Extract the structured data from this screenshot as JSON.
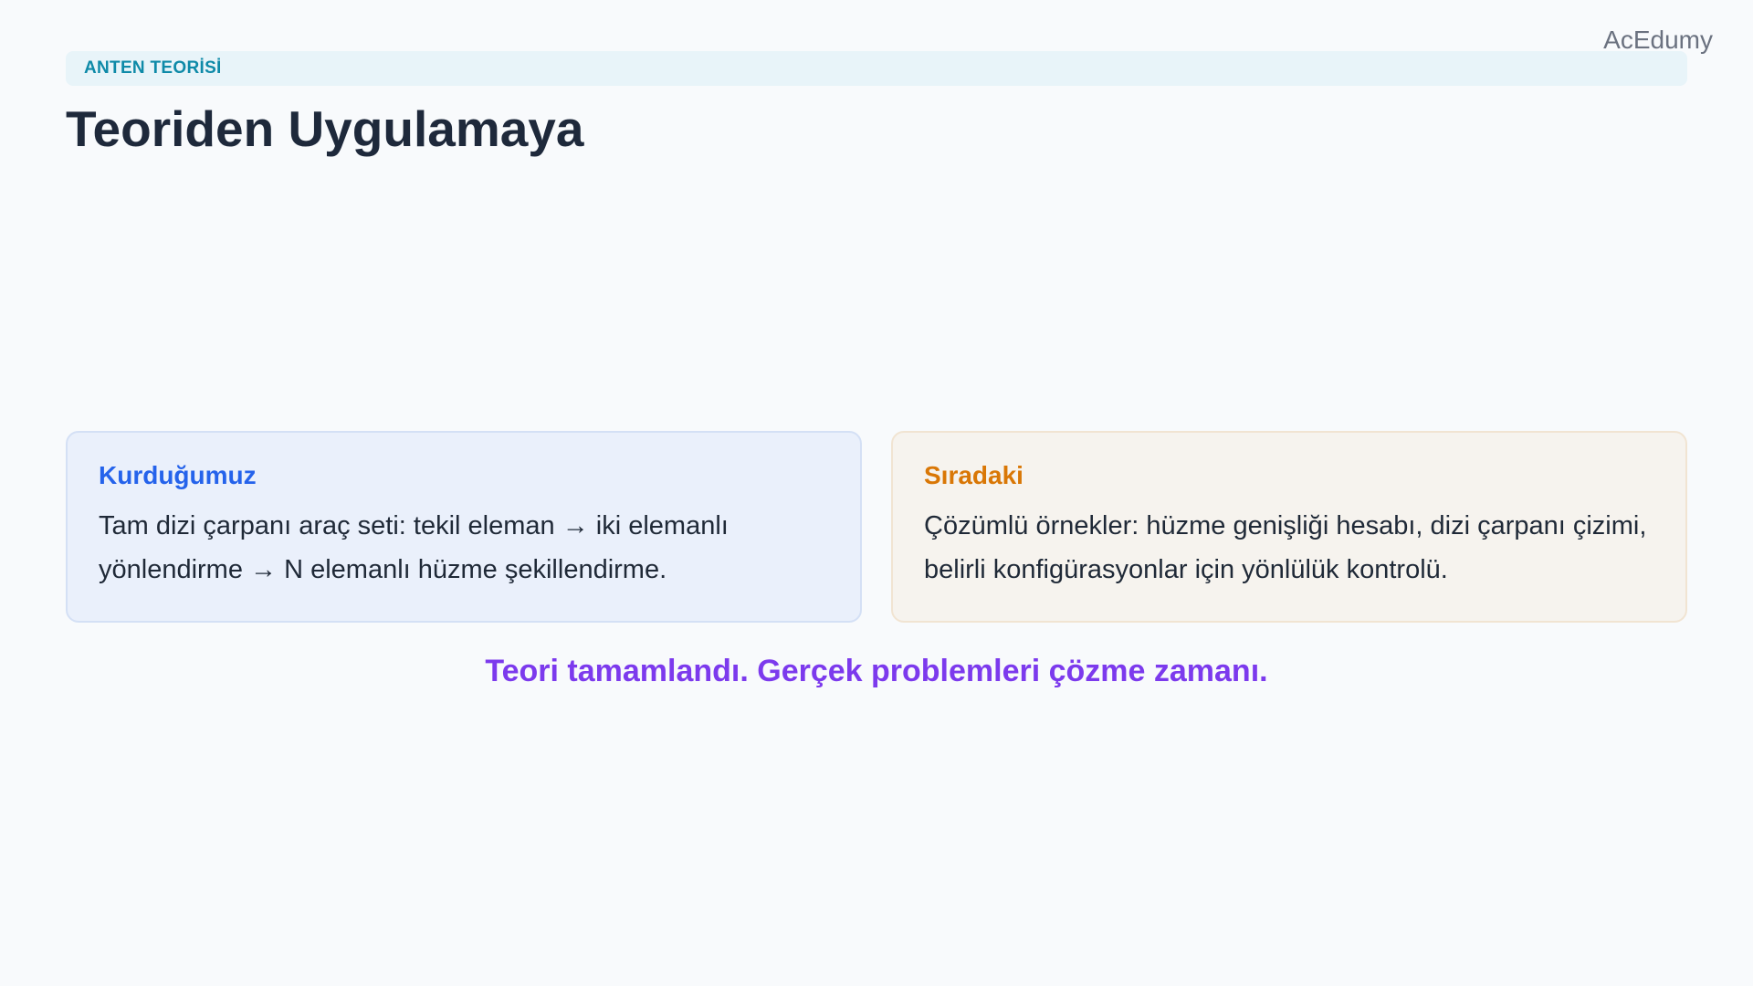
{
  "brand": "AcEdumy",
  "section_tag": "ANTEN TEORİSİ",
  "title": "Teoriden Uygulamaya",
  "cards": [
    {
      "heading": "Kurduğumuz",
      "body": "Tam dizi çarpanı araç seti: tekil eleman → iki elemanlı yönlendirme → N elemanlı hüzme şekillendirme.",
      "accent_color": "#2563eb"
    },
    {
      "heading": "Sıradaki",
      "body": "Çözümlü örnekler: hüzme genişliği hesabı, dizi çarpanı çizimi, belirli konfigürasyonlar için yönlülük kontrolü.",
      "accent_color": "#d97706"
    }
  ],
  "closing": "Teori tamamlandı. Gerçek problemleri çözme zamanı.",
  "colors": {
    "background": "#f8fafc",
    "section_tag": "#0e8aa8",
    "title": "#1e293b",
    "closing": "#7c3aed"
  }
}
